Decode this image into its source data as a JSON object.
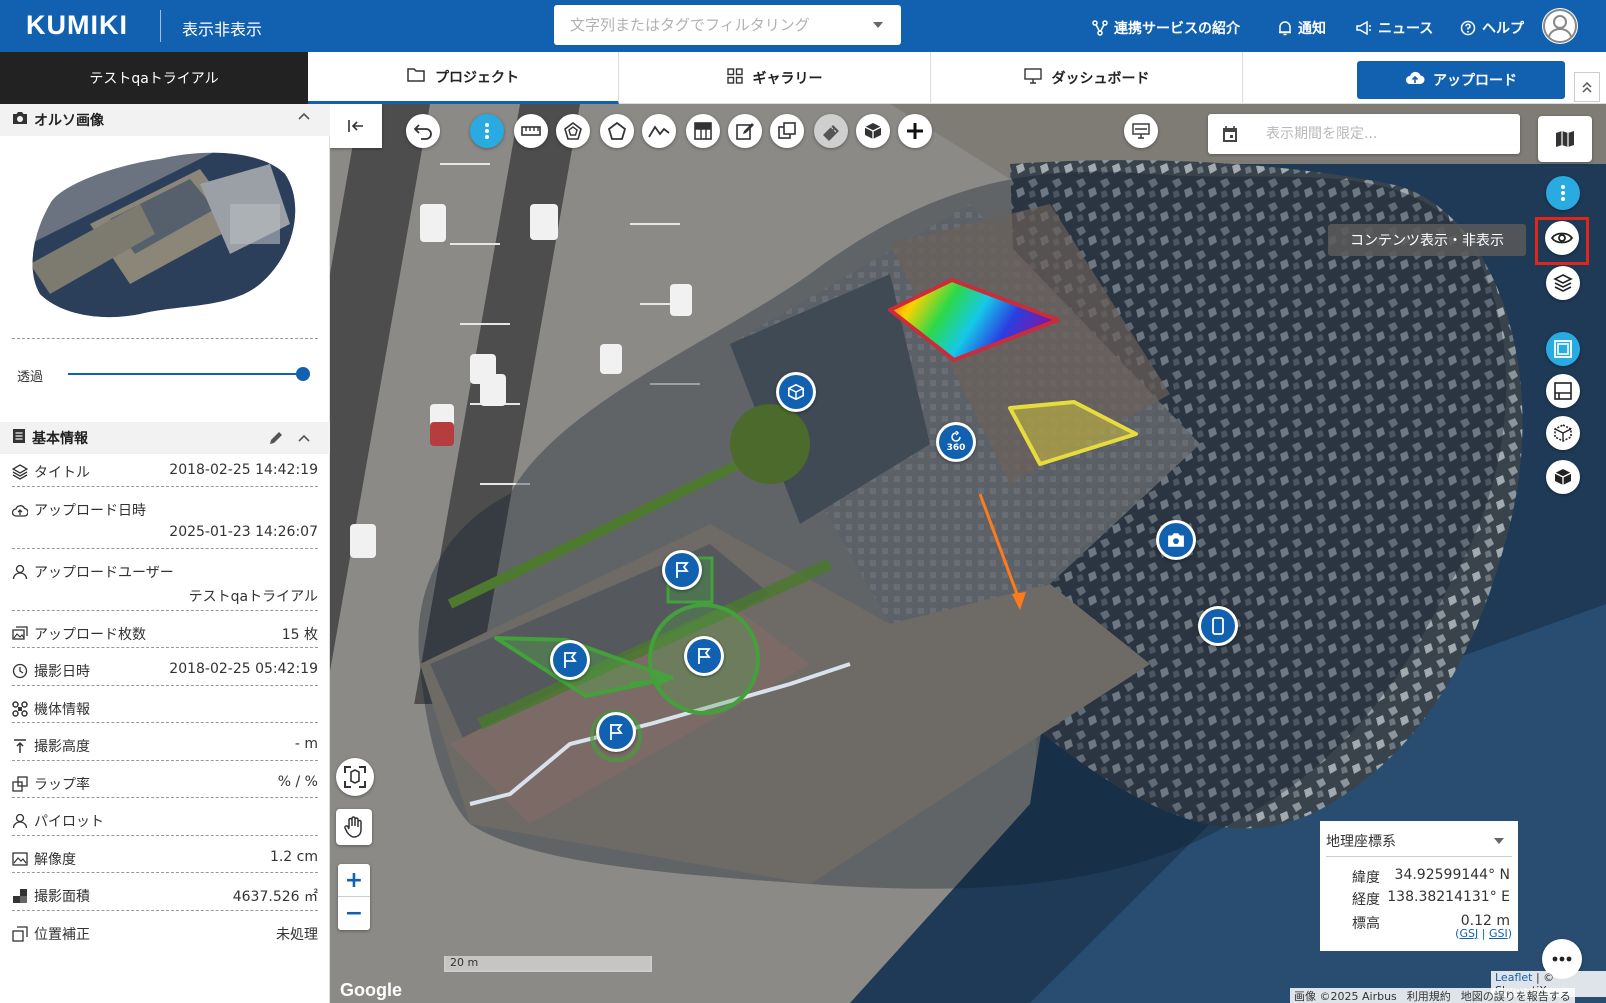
{
  "header": {
    "logo": "KUMIKI",
    "toggle_display": "表示非表示",
    "filter_placeholder": "文字列またはタグでフィルタリング",
    "nav": {
      "services": "連携サービスの紹介",
      "notifications": "通知",
      "news": "ニュース",
      "help": "ヘルプ"
    }
  },
  "tabbar": {
    "project_name": "テストqaトライアル",
    "tabs": [
      {
        "label": "プロジェクト",
        "icon": "folder-icon",
        "active": true
      },
      {
        "label": "ギャラリー",
        "icon": "grid-icon",
        "active": false
      },
      {
        "label": "ダッシュボード",
        "icon": "monitor-icon",
        "active": false
      }
    ],
    "upload_label": "アップロード"
  },
  "sidebar": {
    "ortho": {
      "title": "オルソ画像",
      "transparency_label": "透過",
      "transparency_value": 1.0
    },
    "basic_info": {
      "title": "基本情報",
      "rows": [
        {
          "label": "タイトル",
          "icon": "layers-icon",
          "value": "2018-02-25 14:42:19"
        },
        {
          "label": "アップロード日時",
          "icon": "cloud-upload-icon",
          "value": "2025-01-23 14:26:07"
        },
        {
          "label": "アップロードユーザー",
          "icon": "user-icon",
          "value": "テストqaトライアル"
        },
        {
          "label": "アップロード枚数",
          "icon": "images-icon",
          "value": "15 枚"
        },
        {
          "label": "撮影日時",
          "icon": "clock-icon",
          "value": "2018-02-25 05:42:19"
        },
        {
          "label": "機体情報",
          "icon": "drone-icon",
          "value": ""
        },
        {
          "label": "撮影高度",
          "icon": "altitude-icon",
          "value": "- m"
        },
        {
          "label": "ラップ率",
          "icon": "overlap-icon",
          "value": "% / %"
        },
        {
          "label": "パイロット",
          "icon": "pilot-icon",
          "value": ""
        },
        {
          "label": "解像度",
          "icon": "image-icon",
          "value": "1.2 cm"
        },
        {
          "label": "撮影面積",
          "icon": "area-icon",
          "value": "4637.526 ㎡"
        },
        {
          "label": "位置補正",
          "icon": "copy-icon",
          "value": "未処理"
        }
      ]
    }
  },
  "map": {
    "date_placeholder": "表示期間を限定...",
    "tooltip": "コンテンツ表示・非表示",
    "coords": {
      "system": "地理座標系",
      "lat_label": "緯度",
      "lat_value": "34.92599144° N",
      "lon_label": "経度",
      "lon_value": "138.38214131° E",
      "alt_label": "標高",
      "alt_value": "0.12 m",
      "link_gsj": "GSJ",
      "link_gsi": "GSI"
    },
    "marker_360_label": "360",
    "scale_label": "20 m",
    "google_label": "Google",
    "attribution": {
      "leaflet": "Leaflet",
      "skymatix": "© SkymatiX",
      "imagery": "画像 ©2025 Airbus",
      "terms": "利用規約",
      "report": "地図の誤りを報告する"
    }
  },
  "colors": {
    "brand": "#1161b0",
    "tool_active": "#29abe2",
    "highlight": "#e0261b"
  }
}
